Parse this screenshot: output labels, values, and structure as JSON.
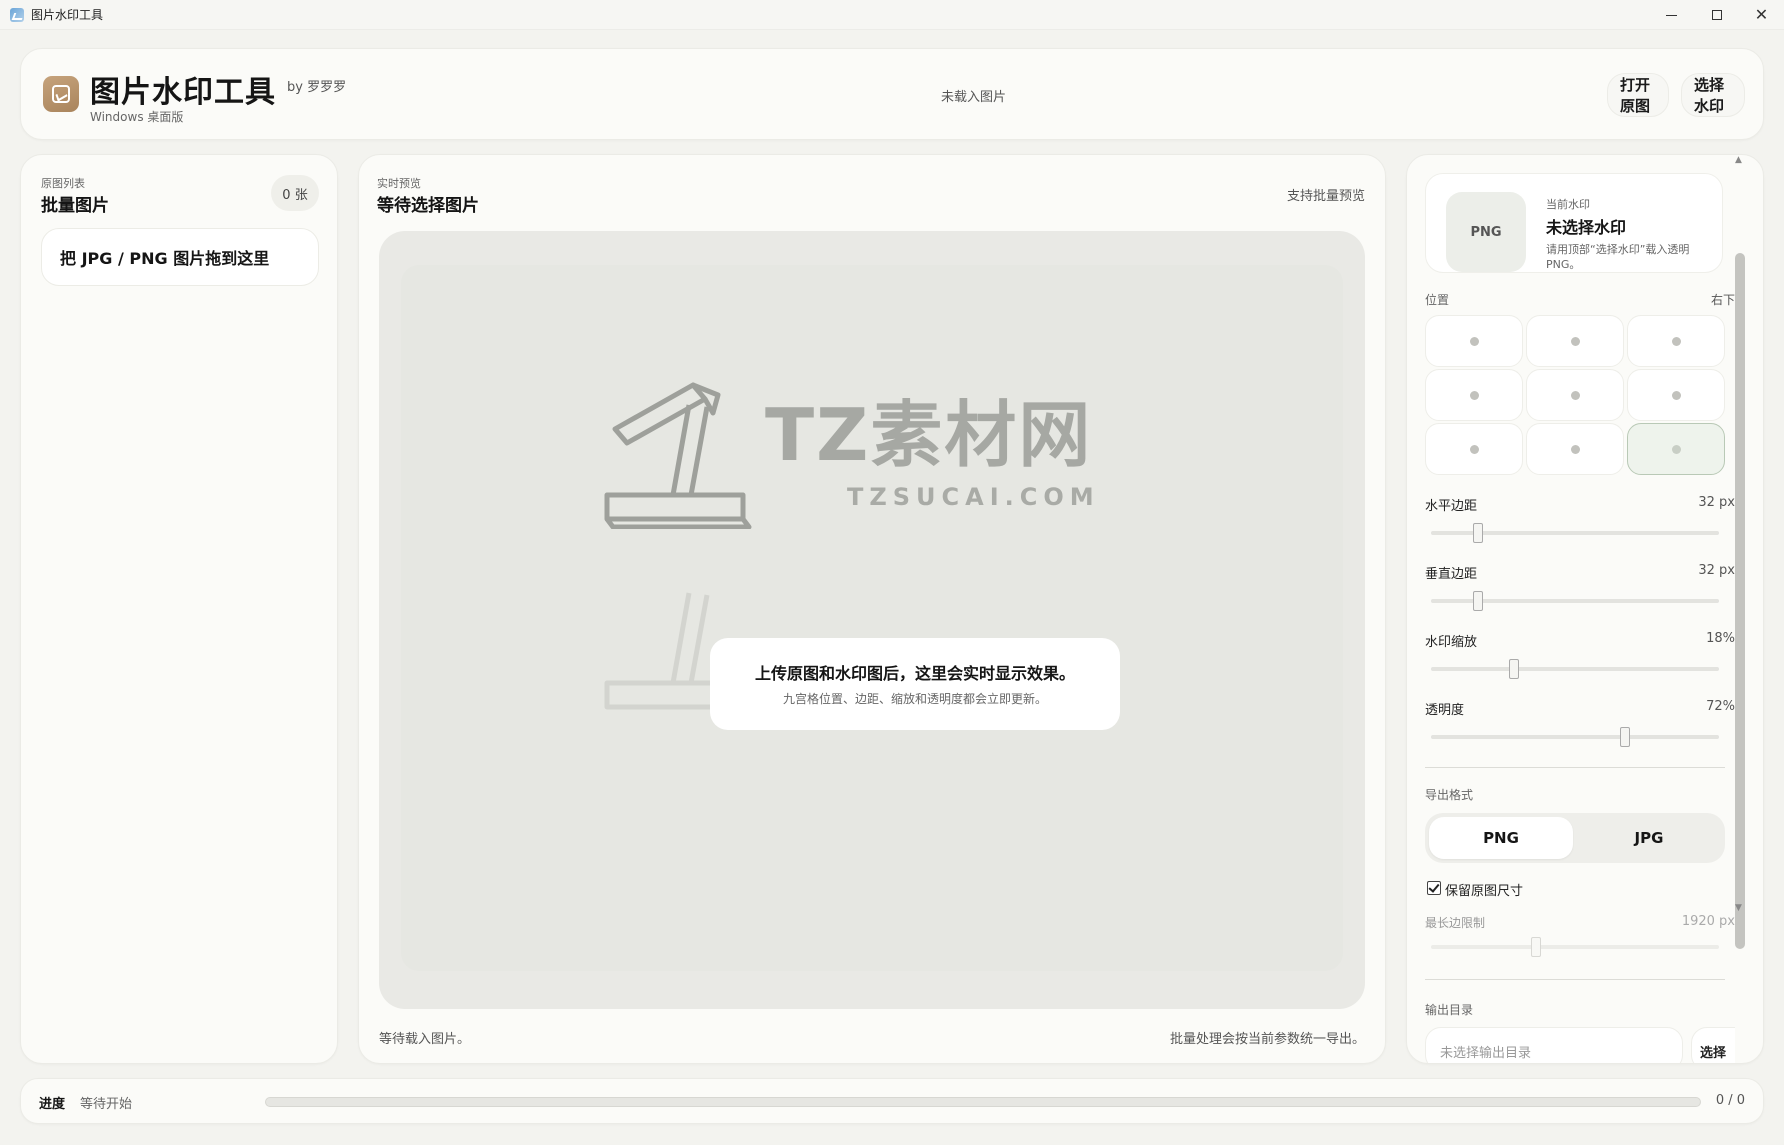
{
  "window": {
    "title": "图片水印工具",
    "controls": {
      "minimize": "minimize-icon",
      "maximize": "maximize-icon",
      "close": "close-icon"
    }
  },
  "header": {
    "app_name": "图片水印工具",
    "by": "by 罗罗罗",
    "subtitle": "Windows 桌面版",
    "status": "未载入图片",
    "open_button": "打开原图",
    "watermark_button": "选择水印",
    "logo_icon": "image-icon",
    "logo_color": "#b08c64"
  },
  "left": {
    "caption": "原图列表",
    "title": "批量图片",
    "count": "0 张",
    "drop_hint": "把 JPG / PNG 图片拖到这里"
  },
  "center": {
    "caption": "实时预览",
    "title": "等待选择图片",
    "hint": "支持批量预览",
    "watermark_main": "TZ素材网",
    "watermark_url": "TZSUCAI.COM",
    "empty_title": "上传原图和水印图后，这里会实时显示效果。",
    "empty_sub": "九宫格位置、边距、缩放和透明度都会立即更新。",
    "footer_left": "等待载入图片。",
    "footer_right": "批量处理会按当前参数统一导出。"
  },
  "right": {
    "watermark": {
      "tile": "PNG",
      "caption": "当前水印",
      "name": "未选择水印",
      "desc": "请用顶部“选择水印”载入透明 PNG。"
    },
    "position": {
      "label": "位置",
      "value": "右下",
      "selected_index": 8
    },
    "h_margin": {
      "label": "水平边距",
      "value": "32 px",
      "fraction": 0.15
    },
    "v_margin": {
      "label": "垂直边距",
      "value": "32 px",
      "fraction": 0.15
    },
    "scale": {
      "label": "水印缩放",
      "value": "18%",
      "fraction": 0.28
    },
    "opacity": {
      "label": "透明度",
      "value": "72%",
      "fraction": 0.68
    },
    "format": {
      "label": "导出格式",
      "options": [
        "PNG",
        "JPG"
      ],
      "selected": "PNG"
    },
    "keep_size": {
      "label": "保留原图尺寸",
      "checked": true
    },
    "max_edge": {
      "label": "最长边限制",
      "value": "1920 px",
      "fraction": 0.36
    },
    "output": {
      "label": "输出目录",
      "placeholder": "未选择输出目录",
      "button": "选择"
    }
  },
  "footer": {
    "label": "进度",
    "status": "等待开始",
    "progress": 0,
    "count": "0 / 0"
  }
}
